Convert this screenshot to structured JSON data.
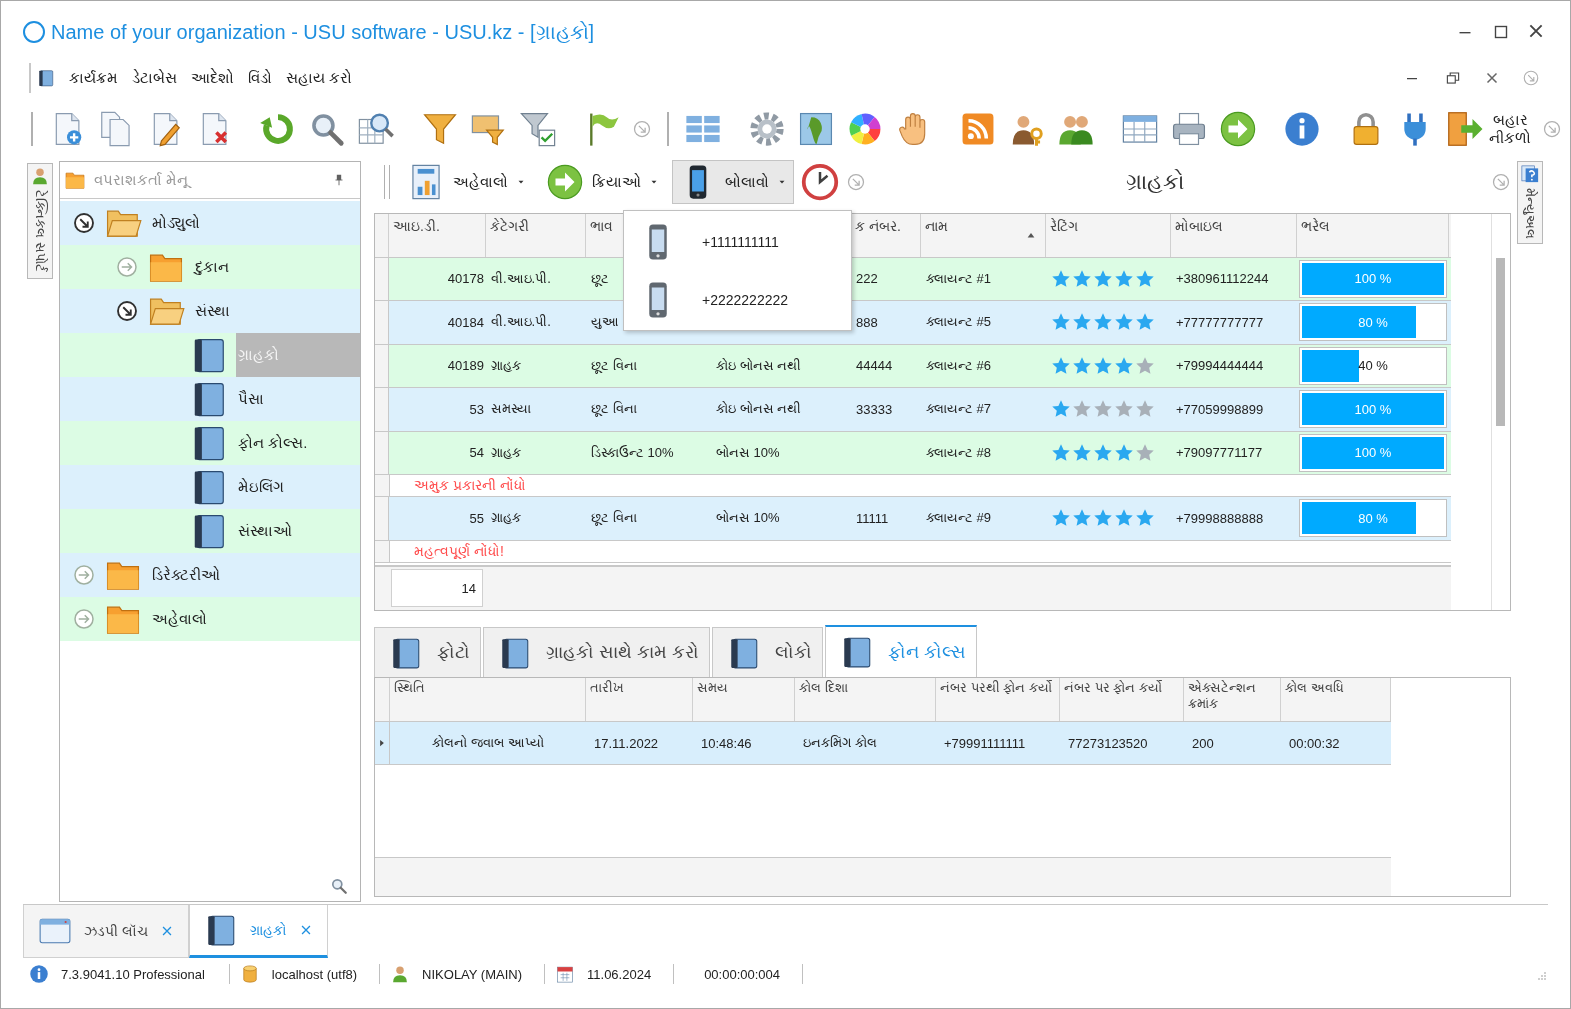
{
  "window": {
    "title": "Name of your organization - USU software - USU.kz - [ગ્રાહકો]"
  },
  "menu": {
    "items": [
      "કાર્યક્રમ",
      "ડેટાબેસ",
      "આદેશો",
      "વિંડો",
      "સહાય કરો"
    ]
  },
  "toolbar": {
    "exit_button": "બહાર નીકળો"
  },
  "side_tab": {
    "label": "ટેક્નિકલ સપોર્ટ"
  },
  "navigation": {
    "title": "વપરાશકર્તા મેનૂ",
    "tree": [
      {
        "label": "મોડ્યુલો",
        "kind": "folder",
        "expanded": true,
        "selected": false,
        "children": [
          {
            "label": "દુકાન",
            "kind": "folder",
            "expanded": false,
            "selected": false
          },
          {
            "label": "સંસ્થા",
            "kind": "folder",
            "expanded": true,
            "selected": false,
            "children": [
              {
                "label": "ગ્રાહકો",
                "kind": "page",
                "selected": true
              },
              {
                "label": "પૈસા",
                "kind": "page",
                "selected": false
              },
              {
                "label": "ફોન કોલ્સ.",
                "kind": "page",
                "selected": false
              },
              {
                "label": "મેઇલિંગ",
                "kind": "page",
                "selected": false
              },
              {
                "label": "સંસ્થાઓ",
                "kind": "page",
                "selected": false
              }
            ]
          }
        ]
      },
      {
        "label": "ડિરેક્ટરીઓ",
        "kind": "folder",
        "expanded": false,
        "selected": false
      },
      {
        "label": "અહેવાલો",
        "kind": "folder",
        "expanded": false,
        "selected": false
      }
    ]
  },
  "module": {
    "title": "ગ્રાહકો",
    "buttons": [
      {
        "label": "અહેવાલો",
        "kind": "report",
        "pressed": false
      },
      {
        "label": "ક્રિયાઓ",
        "kind": "actions",
        "pressed": false
      },
      {
        "label": "બોલાવો",
        "kind": "call",
        "pressed": true
      }
    ],
    "call_menu": [
      "+1111111111",
      "+2222222222"
    ]
  },
  "clients": {
    "columns": [
      {
        "label": "આઇ.ડી.",
        "sorted": false
      },
      {
        "label": "કેટેગરી",
        "sorted": false
      },
      {
        "label": "ભાવ"
      },
      {},
      {
        "label": "ક નંબર.",
        "sorted": false
      },
      {
        "label": "નામ",
        "sorted": true
      },
      {
        "label": "રેટિંગ",
        "sorted": false
      },
      {
        "label": "મોબાઇલ",
        "sorted": false
      },
      {
        "label": "ભરેલ",
        "sorted": false
      }
    ],
    "rows": [
      {
        "id": "40178",
        "category": "વી.આઇ.પી.",
        "column_3": "છૂટ",
        "column_5": "222",
        "name": "ક્લાયન્ટ #1",
        "stars": 5,
        "mobile": "+380961112244",
        "level": 1,
        "fill_label": "100 %"
      },
      {
        "id": "40184",
        "category": "વી.આઇ.પી.",
        "column_3": "યુઆ",
        "column_5": "888",
        "name": "ક્લાયન્ટ #5",
        "stars": 5,
        "mobile": "+77777777777",
        "level": 0.8,
        "fill_label": "80 %"
      },
      {
        "id": "40189",
        "category": "ગ્રાહક",
        "column_3": "છૂટ વિના",
        "column_4": "કોઇ બોનસ નથી",
        "column_5": "44444",
        "name": "ક્લાયન્ટ #6",
        "stars": 4,
        "mobile": "+79994444444",
        "level": 0.4,
        "fill_label": "40 %"
      },
      {
        "id": "53",
        "category": "સમસ્યા",
        "column_3": "છૂટ વિના",
        "column_4": "કોઇ બોનસ નથી",
        "column_5": "33333",
        "name": "ક્લાયન્ટ #7",
        "stars": 1,
        "mobile": "+77059998899",
        "level": 1,
        "fill_label": "100 %"
      },
      {
        "id": "54",
        "category": "ગ્રાહક",
        "column_3": "ડિસ્કાઉન્ટ 10%",
        "column_4": "બોનસ 10%",
        "name": "ક્લાયન્ટ #8",
        "stars": 4,
        "mobile": "+79097771177",
        "level": 1,
        "fill_label": "100 %",
        "note": "અમુક પ્રકારની નોંધો"
      },
      {
        "id": "55",
        "category": "ગ્રાહક",
        "column_3": "છૂટ વિના",
        "column_4": "બોનસ 10%",
        "column_5": "11111",
        "name": "ક્લાયન્ટ #9",
        "stars": 5,
        "mobile": "+79998888888",
        "level": 0.8,
        "fill_label": "80 %",
        "note": "મહત્વપૂર્ણ નોંધો!"
      }
    ],
    "summary": "14"
  },
  "detail_tabs": [
    {
      "label": "ફોટો",
      "selected": false
    },
    {
      "label": "ગ્રાહકો સાથે કામ કરો",
      "selected": false
    },
    {
      "label": "લોકો",
      "selected": false
    },
    {
      "label": "ફોન કોલ્સ",
      "selected": true
    }
  ],
  "calls": {
    "columns": [
      "સ્થિતિ",
      "તારીખ",
      "સમય",
      "કોલ દિશા",
      "નંબર પરથી ફોન કર્યો",
      "નંબર પર ફોન કર્યો",
      "એક્સટેન્શન ક્રમાંક",
      "કોલ અવધિ"
    ],
    "rows": [
      {
        "current": true,
        "cells": [
          "કોલનો જવાબ આપ્યો",
          "17.11.2022",
          "10:48:46",
          "ઇનકમિંગ કોલ",
          "+79991111111",
          "77273123520",
          "200",
          "00:00:32"
        ]
      }
    ]
  },
  "help_tab": {
    "label": "મેન્યુઅલ"
  },
  "documents": [
    {
      "label": "ઝડપી લૉંચ",
      "kind": "window",
      "selected": false
    },
    {
      "label": "ગ્રાહકો",
      "kind": "page",
      "selected": true
    }
  ],
  "status_bar": [
    {
      "kind": "info",
      "text": "7.3.9041.10 Professional"
    },
    {
      "kind": "database",
      "text": "localhost (utf8)"
    },
    {
      "kind": "user",
      "text": "NIKOLAY (MAIN)"
    },
    {
      "kind": "calendar",
      "text": "11.06.2024"
    },
    {
      "kind": "plain",
      "text": "00:00:00:004"
    }
  ]
}
